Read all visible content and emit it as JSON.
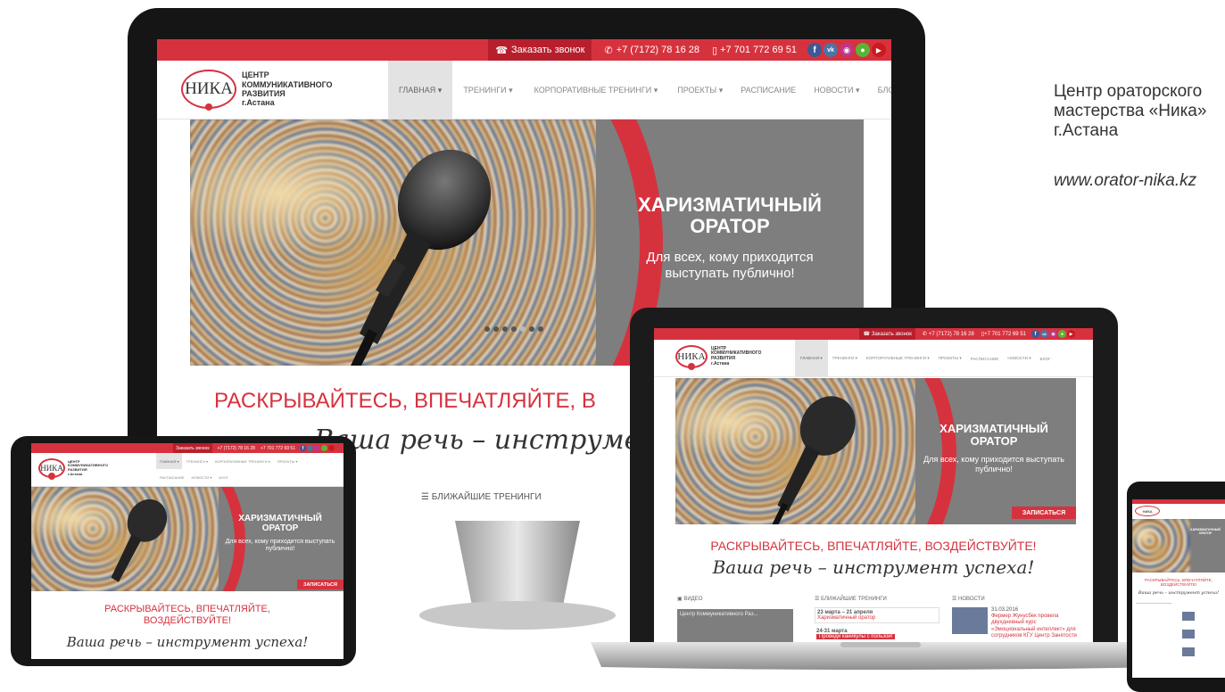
{
  "site": {
    "callback": "Заказать звонок",
    "phone1": "+7 (7172) 78 16 28",
    "phone2": "+7 701 772 69 51",
    "social": [
      "f",
      "vk",
      "ig",
      "od",
      "yt"
    ],
    "logo_mark": "НИКА",
    "logo_line1": "ЦЕНТР",
    "logo_line2": "КОММУНИКАТИВНОГО",
    "logo_line3": "РАЗВИТИЯ",
    "logo_city": "г.Астана",
    "nav": [
      "ГЛАВНАЯ ▾",
      "ТРЕНИНГИ ▾",
      "КОРПОРАТИВНЫЕ ТРЕНИНГИ ▾",
      "ПРОЕКТЫ ▾",
      "РАСПИСАНИЕ",
      "НОВОСТИ ▾",
      "БЛОГ"
    ],
    "nav_tablet_row1": [
      "ГЛАВНАЯ ▾",
      "ТРЕНИНГИ ▾",
      "КОРПОРАТИВНЫЕ ТРЕНИНГИ ▾",
      "ПРОЕКТЫ ▾"
    ],
    "nav_tablet_row2": [
      "РАСПИСАНИЕ",
      "НОВОСТИ ▾",
      "БЛОГ"
    ],
    "hero_title": "ХАРИЗМАТИЧНЫЙ ОРАТОР",
    "hero_sub": "Для всех, кому приходится выступать публично!",
    "signup": "ЗАПИСАТЬСЯ",
    "slogan": "РАСКРЫВАЙТЕСЬ, ВПЕЧАТЛЯЙТЕ, ВОЗДЕЙСТВУЙТЕ!",
    "slogan_imac": "РАСКРЫВАЙТЕСЬ, ВПЕЧАТЛЯЙТЕ, В",
    "slogan_tablet1": "РАСКРЫВАЙТЕСЬ, ВПЕЧАТЛЯЙТЕ,",
    "slogan_tablet2": "ВОЗДЕЙСТВУЙТЕ!",
    "script": "Ваша речь – инструмент успеха!",
    "script_imac": "Ваша речь – инструмент",
    "upcoming": "☰ БЛИЖАЙШИЕ ТРЕНИНГИ",
    "video": "▣ ВИДЕО",
    "news": "☰ НОВОСТИ",
    "video_caption": "Центр Коммуникативного Раз...",
    "t1_date": "23 марта – 21 апреля",
    "t1_name": "Харизматичный оратор",
    "t2_date": "24-31 марта",
    "t2_name": "Проведи каникулы с пользой!",
    "news_date": "31.03.2016",
    "news_text": "Фермер Жунусбек провела двухдневный курс «Эмоциональный интеллект» для сотрудников КГУ Центр Занятости"
  },
  "side": {
    "line1": "Центр ораторского",
    "line2": "мастерства «Ника»",
    "line3": "г.Астана",
    "link": "www.orator-nika.kz"
  },
  "colors": {
    "brand": "#d6323e",
    "dark": "#151515",
    "grey": "#7e7e7e"
  }
}
